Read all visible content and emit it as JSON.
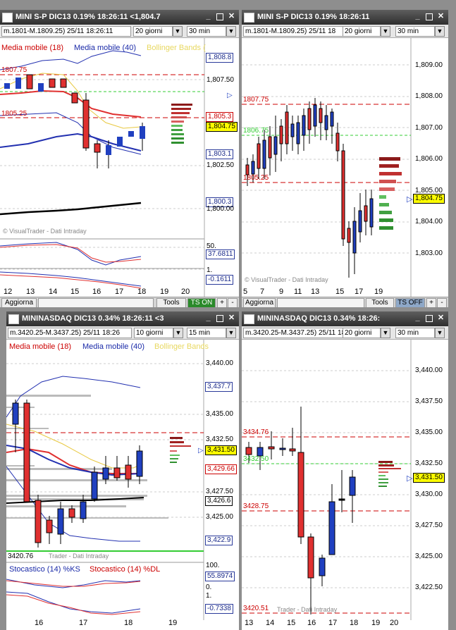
{
  "colors": {
    "accent_red": "#c00000",
    "accent_blue": "#1a2aa8",
    "current_price_bg": "#ffff00",
    "ts_on": "#2a8a2a",
    "ts_off": "#8ea8c8"
  },
  "panels": {
    "tl": {
      "title": "MINI S-P DIC13 0.19% 18:26:11 <1,804.7",
      "range": "m.1801-M.1809.25) 25/11 18:26:11",
      "period": "20 giorni",
      "interval": "30 min",
      "legend": [
        "Media mobile (18)",
        "Media mobile (40)",
        "Bollinger Bands ("
      ],
      "levels": {
        "top": "1807.75",
        "bottom": "1805.25"
      },
      "watermark": "© VisualTrader - Dati Intraday",
      "price_boxes": [
        "1,808.8",
        "1,805.3",
        "1,804.75",
        "1,803.1",
        "1,800.3",
        "37.6811",
        "-0.1611"
      ],
      "axis": [
        "1,807.50",
        "1,802.50",
        "1,800.00",
        "50.",
        "1."
      ],
      "xaxis": [
        "12",
        "13",
        "14",
        "15",
        "16",
        "17",
        "18",
        "19",
        "20"
      ],
      "bottom": {
        "aggiorna": "Aggiorna",
        "tools": "Tools",
        "ts": "TS ON",
        "plus": "+",
        "minus": "-"
      }
    },
    "tr": {
      "title": "MINI S-P DIC13 0.19% 18:26:11",
      "range": "m.1801-M.1809.25) 25/11 18",
      "period": "20 giorni",
      "interval": "30 min",
      "levels": {
        "top": "1807.75",
        "mid": "1806.75",
        "bottom": "1805.25"
      },
      "watermark": "© VisualTrader - Dati Intraday",
      "current": "1,804.75",
      "axis": [
        "1,809.00",
        "1,808.00",
        "1,807.00",
        "1,806.00",
        "1,805.00",
        "1,804.00",
        "1,803.00"
      ],
      "xaxis": [
        "5",
        "7",
        "9",
        "11",
        "13",
        "15",
        "17",
        "19"
      ],
      "bottom": {
        "aggiorna": "Aggiorna",
        "tools": "Tools",
        "ts": "TS OFF",
        "plus": "+",
        "minus": "-"
      }
    },
    "bl": {
      "title": "MININASDAQ DIC13 0.34% 18:26:11 <3",
      "range": "m.3420.25-M.3437.25) 25/11 18:26",
      "period": "10 giorni",
      "interval": "15 min",
      "legend": [
        "Media mobile (18)",
        "Media mobile (40)",
        "Bollinger Bands"
      ],
      "levels": {
        "bottom": "3420.76"
      },
      "watermark": "Trader - Dati Intraday",
      "stoch_legend": [
        "Stocastico (14) %KS",
        "Stocastico (14) %DL"
      ],
      "price_boxes": [
        "3,437.7",
        "3,431.50",
        "3,429.66",
        "3,426.6",
        "3,422.9",
        "55.8974",
        "-0.7338"
      ],
      "axis": [
        "3,440.00",
        "3,435.00",
        "3,432.50",
        "3,427.50",
        "3,425.00",
        "100.",
        "0.",
        "1."
      ],
      "xaxis": [
        "16",
        "17",
        "18",
        "19"
      ]
    },
    "br": {
      "title": "MININASDAQ DIC13 0.34% 18:26:",
      "range": "m.3420.25-M.3437.25) 25/11 18:",
      "period": "20 giorni",
      "interval": "30 min",
      "levels": {
        "top": "3434.76",
        "mid": "3432.50",
        "lower": "3428.75",
        "bottom": "3420.51"
      },
      "watermark": "Trader - Dati Intraday",
      "current": "3,431.50",
      "axis": [
        "3,440.00",
        "3,437.50",
        "3,435.00",
        "3,432.50",
        "3,430.00",
        "3,427.50",
        "3,425.00",
        "3,422.50"
      ],
      "xaxis": [
        "13",
        "14",
        "15",
        "16",
        "17",
        "18",
        "19",
        "20"
      ]
    }
  }
}
